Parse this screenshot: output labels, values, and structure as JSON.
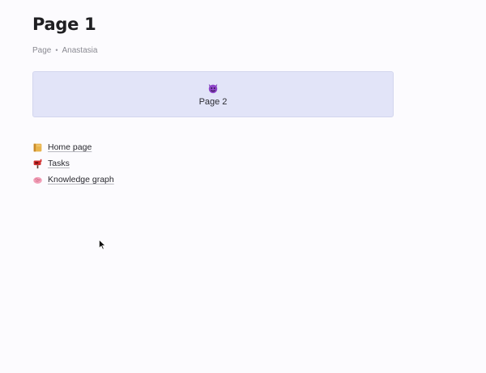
{
  "page": {
    "title": "Page 1",
    "meta_type": "Page",
    "meta_separator": "•",
    "meta_author": "Anastasia"
  },
  "link_card": {
    "icon": "smiling-devil-emoji-icon",
    "label": "Page 2",
    "background_color": "#e2e4f8"
  },
  "links": [
    {
      "icon": "notebook-emoji-icon",
      "label": "Home page"
    },
    {
      "icon": "mailbox-emoji-icon",
      "label": "Tasks"
    },
    {
      "icon": "brain-emoji-icon",
      "label": "Knowledge graph"
    }
  ]
}
